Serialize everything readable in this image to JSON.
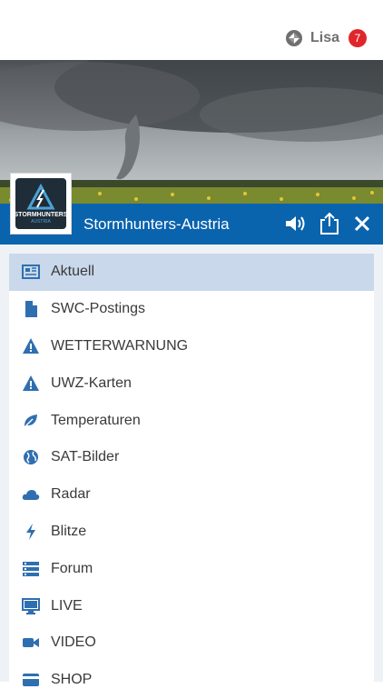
{
  "user": {
    "name": "Lisa",
    "notification_count": "7"
  },
  "header": {
    "title": "Stormhunters-Austria",
    "logo_text": "STORMHUNTERS",
    "logo_sub": "AUSTRIA"
  },
  "colors": {
    "accent": "#0a63ad",
    "active_bg": "#c9d8ea",
    "badge": "#e0262c",
    "icon": "#2f6fb0"
  },
  "menu": {
    "items": [
      {
        "label": "Aktuell",
        "icon": "newspaper-icon",
        "active": true
      },
      {
        "label": "SWC-Postings",
        "icon": "document-icon"
      },
      {
        "label": "WETTERWARNUNG",
        "icon": "warning-icon"
      },
      {
        "label": "UWZ-Karten",
        "icon": "warning-icon"
      },
      {
        "label": "Temperaturen",
        "icon": "leaf-icon"
      },
      {
        "label": "SAT-Bilder",
        "icon": "globe-icon"
      },
      {
        "label": "Radar",
        "icon": "cloud-icon"
      },
      {
        "label": "Blitze",
        "icon": "bolt-icon"
      },
      {
        "label": "Forum",
        "icon": "server-icon"
      },
      {
        "label": "LIVE",
        "icon": "monitor-icon"
      },
      {
        "label": "VIDEO",
        "icon": "video-camera-icon"
      },
      {
        "label": "SHOP",
        "icon": "credit-card-icon"
      }
    ]
  }
}
